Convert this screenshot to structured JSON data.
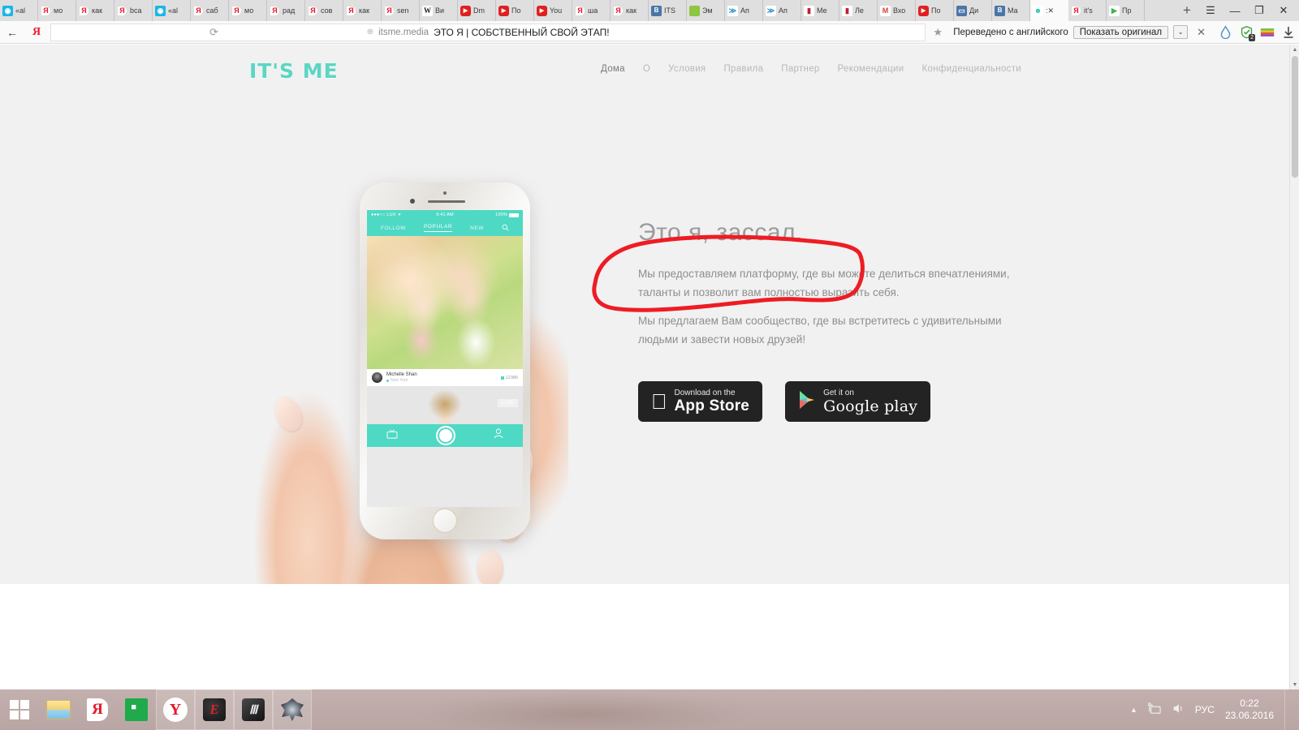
{
  "browser": {
    "tabs": [
      {
        "label": "«al",
        "icon": "eye-icon",
        "type": "eye"
      },
      {
        "label": "мо",
        "icon": "yandex-icon",
        "type": "ya"
      },
      {
        "label": "как",
        "icon": "yandex-icon",
        "type": "ya"
      },
      {
        "label": "bca",
        "icon": "yandex-icon",
        "type": "ya"
      },
      {
        "label": "«al",
        "icon": "eye-icon",
        "type": "eye"
      },
      {
        "label": "саб",
        "icon": "yandex-icon",
        "type": "ya"
      },
      {
        "label": "мо",
        "icon": "yandex-icon",
        "type": "ya"
      },
      {
        "label": "рад",
        "icon": "yandex-icon",
        "type": "ya"
      },
      {
        "label": "сов",
        "icon": "yandex-icon",
        "type": "ya"
      },
      {
        "label": "как",
        "icon": "yandex-icon",
        "type": "ya"
      },
      {
        "label": "sen",
        "icon": "yandex-icon",
        "type": "ya"
      },
      {
        "label": "Ви",
        "icon": "wikipedia-icon",
        "type": "w"
      },
      {
        "label": "Dm",
        "icon": "youtube-icon",
        "type": "yt"
      },
      {
        "label": "По",
        "icon": "youtube-icon",
        "type": "yt"
      },
      {
        "label": "You",
        "icon": "youtube-icon",
        "type": "yt"
      },
      {
        "label": "ша",
        "icon": "yandex-icon",
        "type": "ya"
      },
      {
        "label": "как",
        "icon": "yandex-icon",
        "type": "ya"
      },
      {
        "label": "ITS",
        "icon": "vk-icon",
        "type": "vk"
      },
      {
        "label": "Эм",
        "icon": "green-icon",
        "type": "green"
      },
      {
        "label": "Ап",
        "icon": "bird-icon",
        "type": "blue2"
      },
      {
        "label": "Ап",
        "icon": "bird-icon",
        "type": "blue2"
      },
      {
        "label": "Ме",
        "icon": "bookmark-icon",
        "type": "red"
      },
      {
        "label": "Ле",
        "icon": "bookmark-icon",
        "type": "red"
      },
      {
        "label": "Вхо",
        "icon": "gmail-icon",
        "type": "gm"
      },
      {
        "label": "По",
        "icon": "youtube-icon",
        "type": "yt"
      },
      {
        "label": "Ди",
        "icon": "message-icon",
        "type": "msg"
      },
      {
        "label": "Ма",
        "icon": "vk-icon",
        "type": "vk"
      },
      {
        "label": ":✕",
        "icon": "ghost-icon",
        "type": "teal",
        "active": true
      },
      {
        "label": "it's",
        "icon": "yandex-icon",
        "type": "ya"
      },
      {
        "label": "Пр",
        "icon": "play-icon",
        "type": "play"
      }
    ],
    "new_tab_label": "+",
    "window_controls": {
      "menu": "☰",
      "minimize": "—",
      "restore": "❐",
      "close": "✕"
    },
    "back_label": "←",
    "yandex_label": "Я",
    "reload_label": "⟳",
    "omnibox": {
      "globe": "⊕",
      "domain": "itsme.media",
      "title": "ЭТО Я | СОБСТВЕННЫЙ СВОЙ ЭТАП!",
      "star": "★"
    },
    "translate": {
      "text": "Переведено с английского",
      "button": "Показать оригинал",
      "caret": "⌄",
      "close": "✕"
    },
    "extensions": [
      {
        "name": "adguard-icon",
        "badge": ""
      },
      {
        "name": "shield-icon",
        "badge": "2"
      },
      {
        "name": "winrar-icon",
        "badge": ""
      },
      {
        "name": "download-icon",
        "badge": ""
      }
    ]
  },
  "site": {
    "logo": "IT'S ME",
    "nav": [
      {
        "label": "Дома",
        "active": true
      },
      {
        "label": "О",
        "active": false
      },
      {
        "label": "Условия",
        "active": false
      },
      {
        "label": "Правила",
        "active": false
      },
      {
        "label": "Партнер",
        "active": false
      },
      {
        "label": "Рекомендации",
        "active": false
      },
      {
        "label": "Конфиденциальности",
        "active": false
      }
    ],
    "hero": {
      "title": "Это я, зассал.",
      "paragraph1": "Мы предоставляем платформу, где вы можете делиться впечатлениями, таланты и позволит вам полностью выразить себя.",
      "paragraph2": "Мы предлагаем Вам сообщество, где вы встретитесь с удивительными людьми и завести новых друзей!"
    },
    "stores": {
      "appstore": {
        "sub": "Download on the",
        "main": "App Store",
        "icon": "apple-icon"
      },
      "googleplay": {
        "sub": "Get it on",
        "main": "Google play",
        "icon": "play-triangle-icon"
      }
    },
    "phone_mockup": {
      "status": {
        "carrier": "●●●○○ LUX",
        "wifi": "wifi-icon",
        "time": "9:41 AM",
        "battery": "100%"
      },
      "tabs": [
        {
          "label": "FOLLOW",
          "active": false
        },
        {
          "label": "POPULAR",
          "active": true
        },
        {
          "label": "NEW",
          "active": false
        }
      ],
      "search_icon": "search-icon",
      "post": {
        "username": "Michelle Shan",
        "location": "New York",
        "count": "12386"
      },
      "live_badge": "LIVE",
      "bottom_nav": [
        {
          "icon": "tv-icon"
        },
        {
          "icon": "camera-shutter-icon"
        },
        {
          "icon": "person-icon"
        }
      ]
    }
  },
  "taskbar": {
    "items": [
      {
        "name": "start-button",
        "icon": "windows-icon"
      },
      {
        "name": "file-explorer",
        "icon": "folder-icon"
      },
      {
        "name": "yandex-search",
        "icon": "yandex-icon"
      },
      {
        "name": "windows-store",
        "icon": "store-icon"
      },
      {
        "name": "yandex-browser",
        "icon": "yandex-browser-icon"
      },
      {
        "name": "game-app-1",
        "icon": "red-e-icon"
      },
      {
        "name": "game-app-2",
        "icon": "dark-a-icon"
      },
      {
        "name": "witcher-app",
        "icon": "witcher-icon"
      }
    ],
    "tray": {
      "expand": "▲",
      "network": "network-icon",
      "volume": "volume-icon",
      "language": "РУС",
      "time": "0:22",
      "date": "23.06.2016"
    }
  },
  "colors": {
    "teal": "#4ed9c4",
    "annotation_red": "#ee1c23",
    "page_bg": "#f1f1f1",
    "store_dark": "#232323"
  }
}
